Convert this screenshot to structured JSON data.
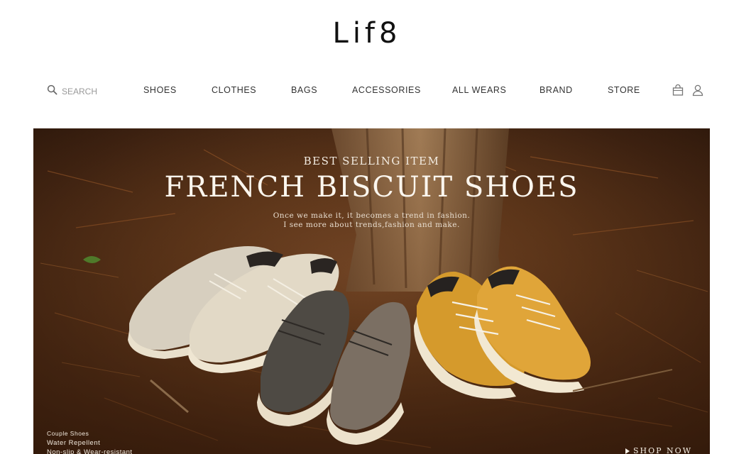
{
  "logo": {
    "text": "Lif8"
  },
  "search": {
    "placeholder": "SEARCH"
  },
  "nav": {
    "items": [
      {
        "label": "SHOES"
      },
      {
        "label": "CLOTHES"
      },
      {
        "label": "BAGS"
      },
      {
        "label": "ACCESSORIES"
      },
      {
        "label": "ALL WEARS"
      },
      {
        "label": "BRAND"
      },
      {
        "label": "STORE"
      }
    ],
    "icons": [
      "search-icon",
      "shopping-bag-icon",
      "user-icon"
    ]
  },
  "hero": {
    "eyebrow": "BEST SELLING ITEM",
    "headline": "FRENCH BISCUIT SHOES",
    "tagline_line1": "Once we make it, it becomes a trend in fashion.",
    "tagline_line2": "I see more about trends,fashion and make.",
    "features": {
      "heading": "Couple Shoes",
      "items": [
        "Water Repellent",
        "Non-slip & Wear-resistant"
      ]
    },
    "cta": "SHOP NOW"
  }
}
